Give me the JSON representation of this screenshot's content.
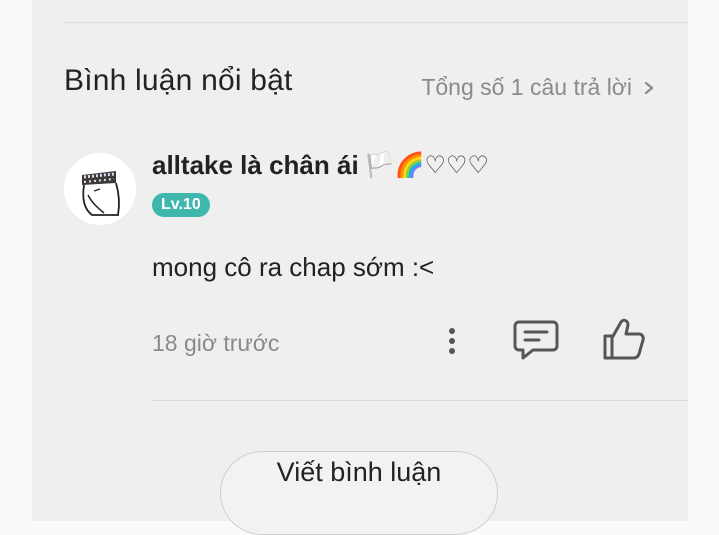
{
  "section": {
    "title": "Bình luận nổi bật",
    "total_replies": "Tổng số 1 câu trả lời"
  },
  "comment": {
    "username": "alltake là chân ái",
    "username_emojis": "🏳️🌈♡♡♡",
    "level_badge": "Lv.10",
    "text": "mong cô ra chap sớm :<",
    "time": "18 giờ trước"
  },
  "actions": {
    "write_comment": "Viết bình luận"
  },
  "colors": {
    "badge": "#3fb7ad",
    "panel_bg": "#efefef",
    "muted_text": "#8a8a8a"
  },
  "icons": [
    "chevron-right-icon",
    "more-vertical-icon",
    "reply-comment-icon",
    "thumbs-up-icon"
  ]
}
